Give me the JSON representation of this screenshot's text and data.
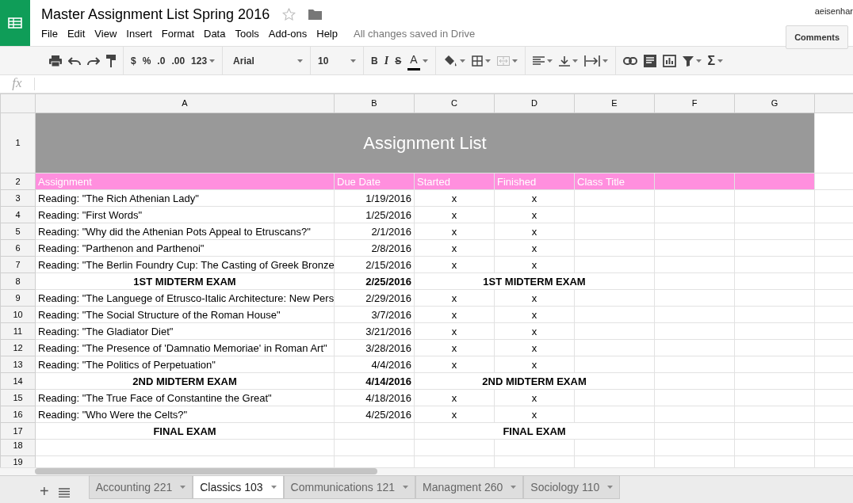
{
  "document": {
    "title": "Master Assignment List Spring 2016",
    "user": "aeisenhar",
    "comments_button": "Comments",
    "save_status": "All changes saved in Drive"
  },
  "menu": [
    "File",
    "Edit",
    "View",
    "Insert",
    "Format",
    "Data",
    "Tools",
    "Add-ons",
    "Help"
  ],
  "toolbar": {
    "currency": "$",
    "percent": "%",
    "decrease_decimals": ".0",
    "increase_decimals": ".00",
    "more_formats": "123",
    "font": "Arial",
    "font_size": "10",
    "bold": "B",
    "italic": "I",
    "strikethrough": "S",
    "text_color": "A",
    "functions": "Σ"
  },
  "formula_bar": {
    "label": "fx"
  },
  "columns": [
    "A",
    "B",
    "C",
    "D",
    "E",
    "F",
    "G"
  ],
  "rows": [
    {
      "number": "1",
      "kind": "title",
      "text": "Assignment List"
    },
    {
      "number": "2",
      "kind": "header",
      "cells": [
        "Assignment",
        "Due Date",
        "Started",
        "Finished",
        "Class Title"
      ]
    },
    {
      "number": "3",
      "kind": "entry",
      "cells": [
        "Reading: \"The Rich Athenian Lady\"",
        "1/19/2016",
        "x",
        "x"
      ]
    },
    {
      "number": "4",
      "kind": "entry",
      "cells": [
        "Reading: \"First Words\"",
        "1/25/2016",
        "x",
        "x"
      ]
    },
    {
      "number": "5",
      "kind": "entry",
      "cells": [
        "Reading: \"Why did the Athenian Pots Appeal to Etruscans?\"",
        "2/1/2016",
        "x",
        "x"
      ]
    },
    {
      "number": "6",
      "kind": "entry",
      "cells": [
        "Reading: \"Parthenon and Parthenoi\"",
        "2/8/2016",
        "x",
        "x"
      ]
    },
    {
      "number": "7",
      "kind": "entry",
      "cells": [
        "Reading: \"The Berlin Foundry Cup: The Casting of Greek Bronze",
        "2/15/2016",
        "x",
        "x"
      ]
    },
    {
      "number": "8",
      "kind": "exam",
      "cells": [
        "1ST MIDTERM EXAM",
        "2/25/2016",
        "1ST MIDTERM EXAM"
      ]
    },
    {
      "number": "9",
      "kind": "entry",
      "cells": [
        "Reading: \"The Languege of Etrusco-Italic Architecture: New Pers",
        "2/29/2016",
        "x",
        "x"
      ]
    },
    {
      "number": "10",
      "kind": "entry",
      "cells": [
        "Reading: \"The Social Structure of the Roman House\"",
        "3/7/2016",
        "x",
        "x"
      ]
    },
    {
      "number": "11",
      "kind": "entry",
      "cells": [
        "Reading: \"The Gladiator Diet\"",
        "3/21/2016",
        "x",
        "x"
      ]
    },
    {
      "number": "12",
      "kind": "entry",
      "cells": [
        "Reading: \"The Presence of 'Damnatio Memoriae' in Roman Art\"",
        "3/28/2016",
        "x",
        "x"
      ]
    },
    {
      "number": "13",
      "kind": "entry",
      "cells": [
        "Reading: \"The Politics of Perpetuation\"",
        "4/4/2016",
        "x",
        "x"
      ]
    },
    {
      "number": "14",
      "kind": "exam",
      "cells": [
        "2ND MIDTERM EXAM",
        "4/14/2016",
        "2ND MIDTERM EXAM"
      ]
    },
    {
      "number": "15",
      "kind": "entry",
      "cells": [
        "Reading: \"The True Face of Constantine the Great\"",
        "4/18/2016",
        "x",
        "x"
      ]
    },
    {
      "number": "16",
      "kind": "entry",
      "cells": [
        "Reading: \"Who Were the Celts?\"",
        "4/25/2016",
        "x",
        "x"
      ]
    },
    {
      "number": "17",
      "kind": "exam",
      "cells": [
        "FINAL EXAM",
        "",
        "FINAL EXAM"
      ]
    },
    {
      "number": "18",
      "kind": "empty"
    },
    {
      "number": "19",
      "kind": "empty"
    }
  ],
  "sheet_tabs": {
    "add": "+",
    "tabs": [
      {
        "label": "Accounting 221",
        "selected": false
      },
      {
        "label": "Classics 103",
        "selected": true
      },
      {
        "label": "Communications 121",
        "selected": false
      },
      {
        "label": "Managment 260",
        "selected": false
      },
      {
        "label": "Sociology 110",
        "selected": false
      }
    ]
  }
}
